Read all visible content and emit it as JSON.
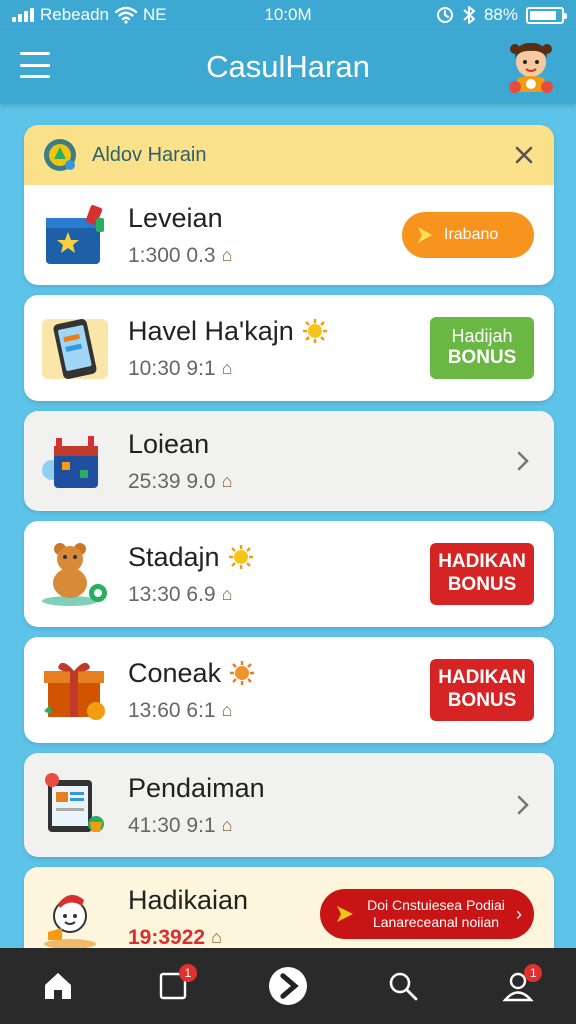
{
  "status_bar": {
    "carrier": "Rebeadn",
    "network": "NE",
    "time": "10:0M",
    "battery": "88%",
    "battery_level": 0.88
  },
  "app": {
    "title": "CasulHaran"
  },
  "header_card": {
    "title": "Aldov Harain"
  },
  "items": [
    {
      "title": "Leveian",
      "subtitle": "1:300 0.3",
      "action": "Irabano"
    },
    {
      "title": "Havel Ha'kajn",
      "subtitle": "10:30 9:1",
      "action_line1": "Hadijah",
      "action_line2": "BONUS"
    },
    {
      "title": "Loiean",
      "subtitle": "25:39 9.0"
    },
    {
      "title": "Stadajn",
      "subtitle": "13:30 6.9",
      "action_line1": "HADIKAN",
      "action_line2": "BONUS"
    },
    {
      "title": "Coneak",
      "subtitle": "13:60 6:1",
      "action_line1": "HADIKAN",
      "action_line2": "BONUS"
    },
    {
      "title": "Pendaiman",
      "subtitle": "41:30 9:1"
    },
    {
      "title": "Hadikaian",
      "subtitle": "19:3922",
      "action_line1": "Doi Cnstuiesea Podiai",
      "action_line2": "Lanareceanal noiian"
    }
  ],
  "lock_glyph": "⌂",
  "colors": {
    "primary": "#3da9d3",
    "background": "#5ec3e8",
    "orange": "#f7941d",
    "green": "#6ab744",
    "red": "#d62424",
    "header_yellow": "#fbe28a",
    "tabbar": "#2a2a2a"
  },
  "tabbar": {
    "tabs": [
      {
        "icon": "home-icon"
      },
      {
        "icon": "square-icon",
        "badge": "1"
      },
      {
        "icon": "play-icon"
      },
      {
        "icon": "search-icon"
      },
      {
        "icon": "user-icon",
        "badge": "1"
      }
    ]
  }
}
